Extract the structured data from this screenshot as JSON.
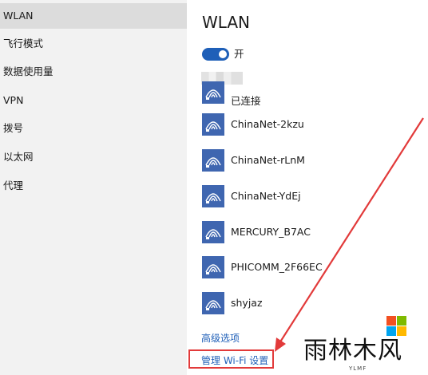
{
  "sidebar": {
    "items": [
      {
        "label": "WLAN",
        "active": true
      },
      {
        "label": "飞行模式"
      },
      {
        "label": "数据使用量"
      },
      {
        "label": "VPN"
      },
      {
        "label": "拨号"
      },
      {
        "label": "以太网"
      },
      {
        "label": "代理"
      }
    ]
  },
  "main": {
    "title": "WLAN",
    "toggle_label": "开",
    "toggle_on": true,
    "networks": [
      {
        "name": "",
        "status": "已连接"
      },
      {
        "name": "ChinaNet-2kzu"
      },
      {
        "name": "ChinaNet-rLnM"
      },
      {
        "name": "ChinaNet-YdEj"
      },
      {
        "name": "MERCURY_B7AC"
      },
      {
        "name": "PHICOMM_2F66EC"
      },
      {
        "name": "shyjaz"
      }
    ],
    "advanced_link": "高级选项",
    "manage_link": "管理 Wi-Fi 设置"
  },
  "watermark": {
    "text": "雨林木风",
    "sub": "YLMF"
  },
  "colors": {
    "accent": "#1e5fb8",
    "wifi_tile": "#3f66b0",
    "highlight_box": "#e23a3a",
    "sidebar_bg": "#f2f2f2"
  }
}
